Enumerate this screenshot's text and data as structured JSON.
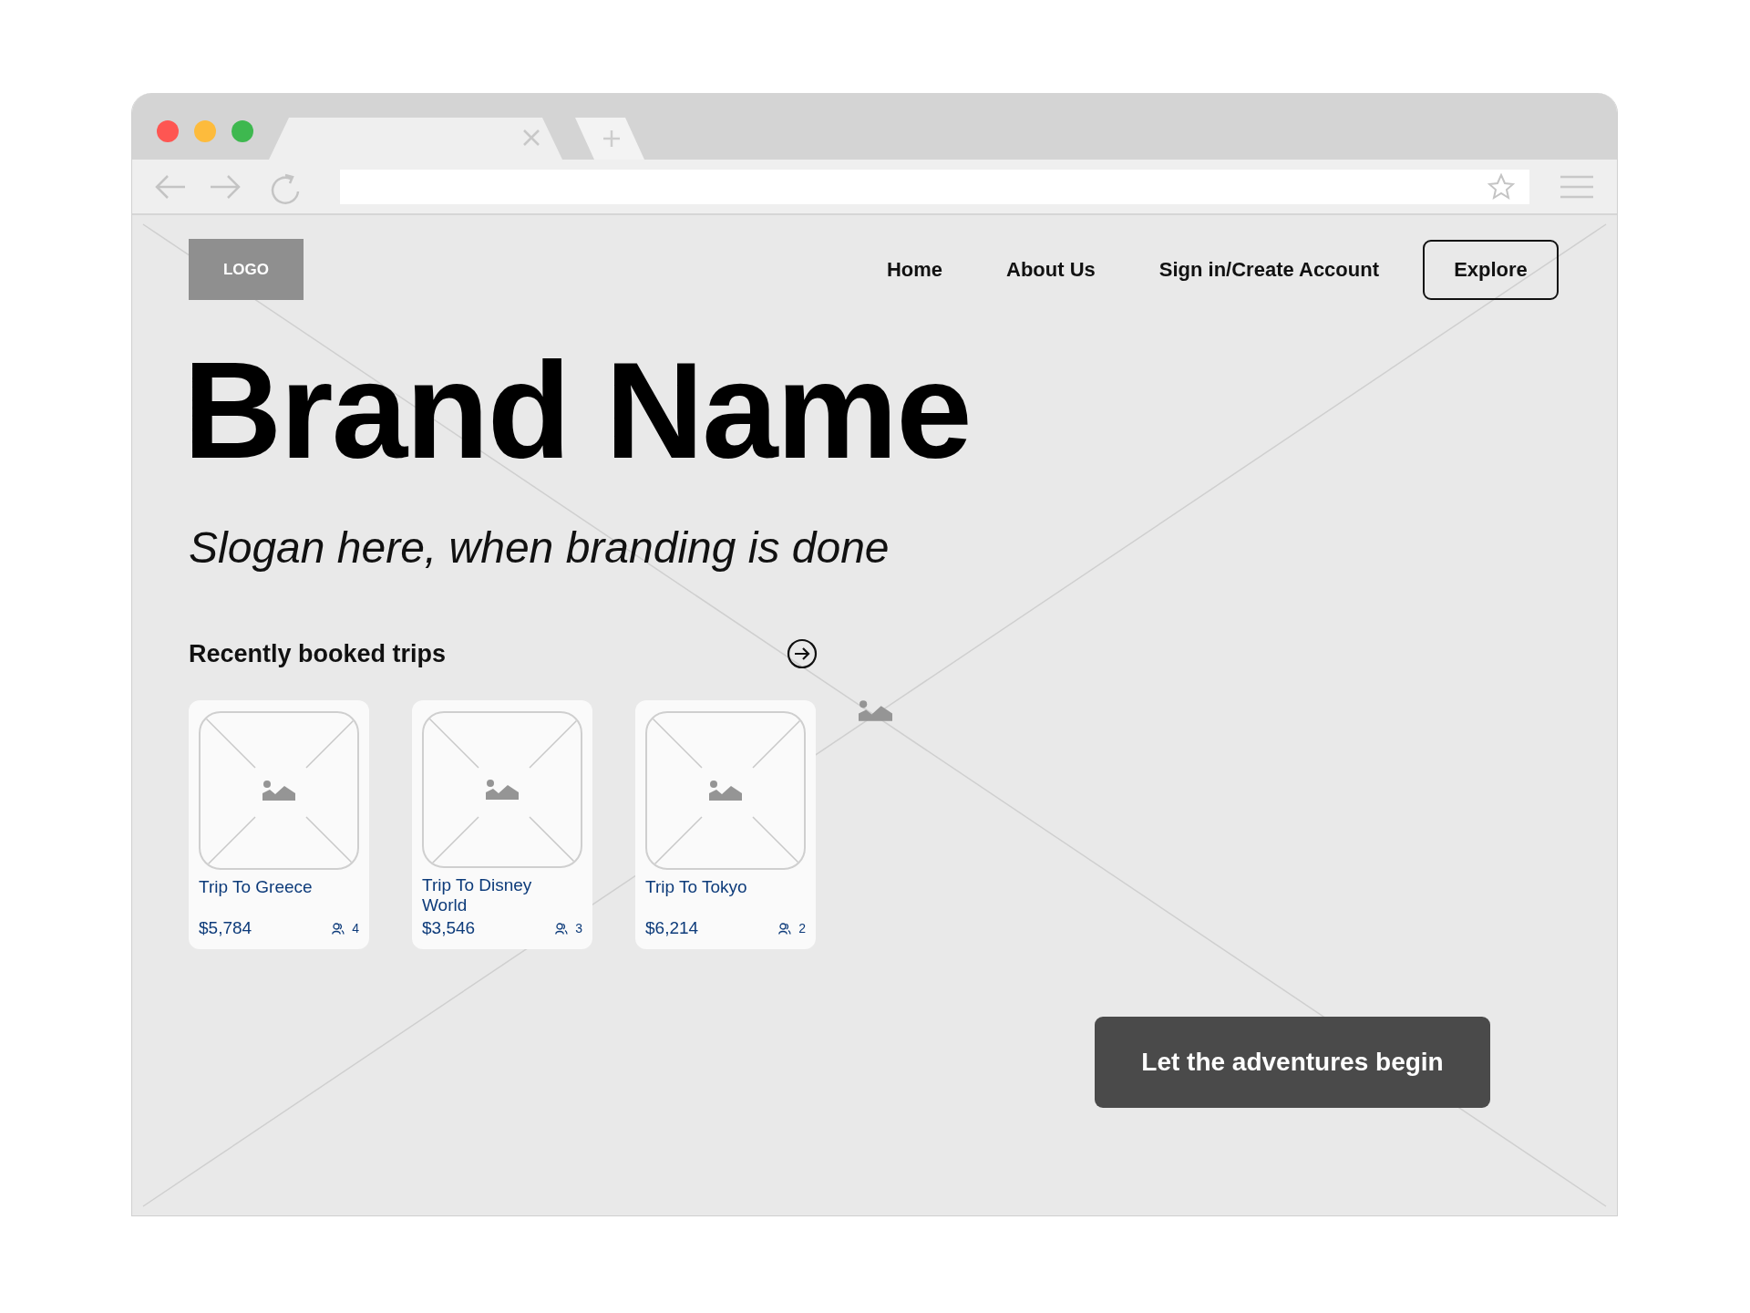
{
  "logo": "LOGO",
  "nav": [
    {
      "label": "Home"
    },
    {
      "label": "About Us"
    },
    {
      "label": "Sign in/Create Account"
    }
  ],
  "explore_button": "Explore",
  "brand_name": "Brand Name",
  "slogan": "Slogan here, when branding is done",
  "recent_trips": {
    "title": "Recently booked trips",
    "cards": [
      {
        "title": "Trip To Greece",
        "price": "$5,784",
        "travelers": "4"
      },
      {
        "title": "Trip To Disney World",
        "price": "$3,546",
        "travelers": "3"
      },
      {
        "title": "Trip To Tokyo",
        "price": "$6,214",
        "travelers": "2"
      }
    ]
  },
  "cta_button": "Let the adventures begin"
}
